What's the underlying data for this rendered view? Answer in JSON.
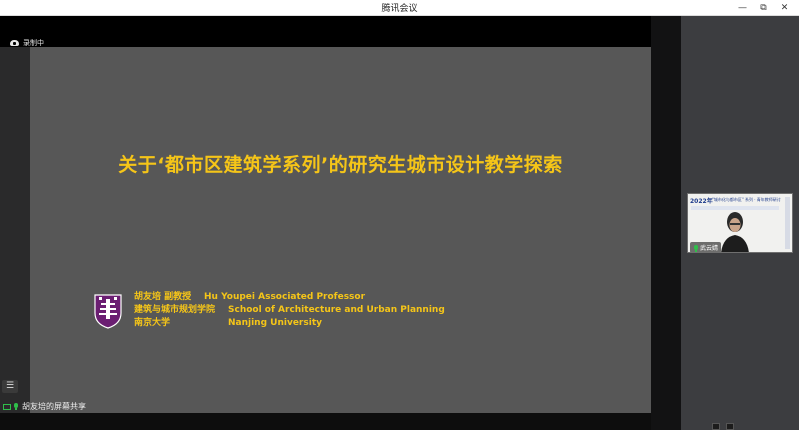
{
  "window": {
    "title": "腾讯会议",
    "controls": [
      "—",
      "⧉",
      "✕"
    ]
  },
  "meeting": {
    "recording_label": "录制中",
    "sharing_label": "胡友培的屏幕共享"
  },
  "slide": {
    "title": "关于‘都市区建筑学系列’的研究生城市设计教学探索",
    "author_rows": [
      {
        "cn": "胡友培  副教授",
        "en": "Hu Youpei Associated Professor"
      },
      {
        "cn": "建筑与城市规划学院",
        "en": "School of Architecture and Urban Planning"
      },
      {
        "cn": "南京大学",
        "en": "Nanjing University"
      }
    ],
    "logo": "nanjing-university-emblem"
  },
  "participant": {
    "name": "武云婧",
    "thumb_text": "2022年",
    "thumb_subtext": "\"城市化与都市区\" 系列 · 青年教师研讨"
  },
  "colors": {
    "slide_bg": "#575757",
    "slide_text": "#f5c518",
    "mic_active": "#2fbf4a",
    "emblem_purple": "#6b1e72"
  }
}
